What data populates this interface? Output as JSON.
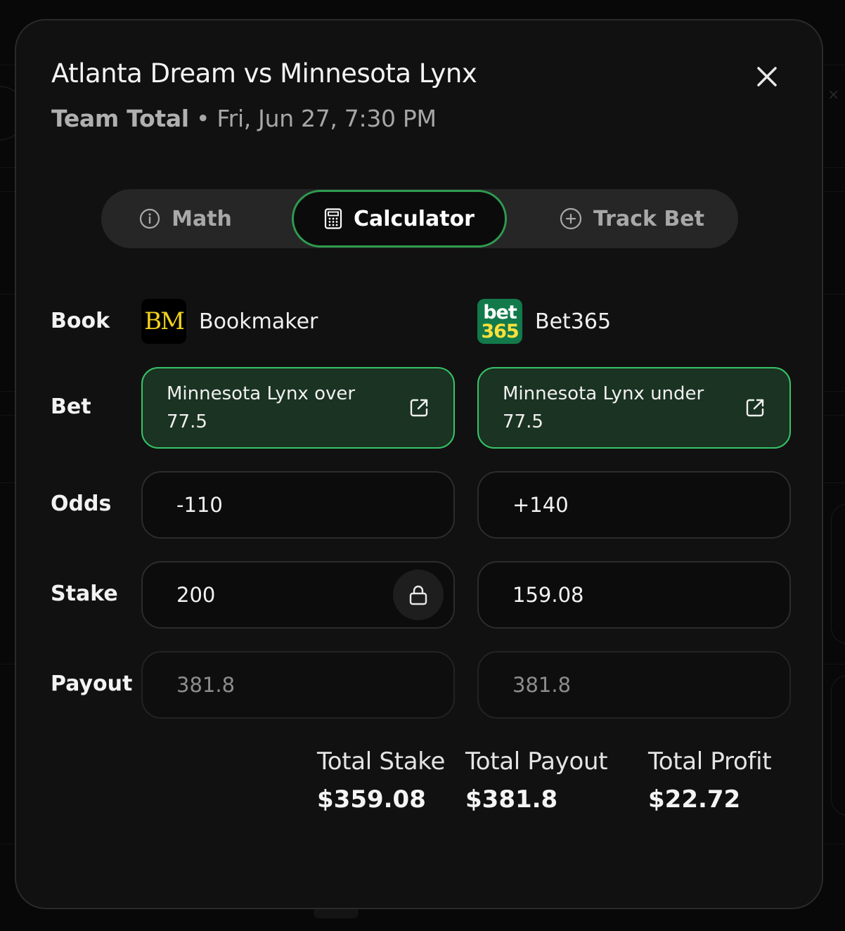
{
  "header": {
    "title": "Atlanta Dream vs Minnesota Lynx",
    "market": "Team Total",
    "separator": "•",
    "datetime": "Fri, Jun 27, 7:30 PM"
  },
  "tabs": [
    {
      "label": "Math",
      "icon": "info-icon"
    },
    {
      "label": "Calculator",
      "icon": "calculator-icon",
      "active": true
    },
    {
      "label": "Track Bet",
      "icon": "plus-circle-icon"
    }
  ],
  "labels": {
    "book": "Book",
    "bet": "Bet",
    "odds": "Odds",
    "stake": "Stake",
    "payout": "Payout"
  },
  "legs": [
    {
      "book_name": "Bookmaker",
      "book_logo_text": "BM",
      "bet": "Minnesota Lynx over 77.5",
      "odds": "-110",
      "stake": "200",
      "stake_locked": true,
      "payout": "381.8"
    },
    {
      "book_name": "Bet365",
      "book_logo_text_top": "bet",
      "book_logo_text_bottom": "365",
      "bet": "Minnesota Lynx under 77.5",
      "odds": "+140",
      "stake": "159.08",
      "payout": "381.8"
    }
  ],
  "totals": {
    "stake_label": "Total Stake",
    "stake_value": "$359.08",
    "payout_label": "Total Payout",
    "payout_value": "$381.8",
    "profit_label": "Total Profit",
    "profit_value": "$22.72"
  },
  "colors": {
    "accent_green": "#35c466",
    "bet_bg": "#1b3322",
    "modal_bg": "#111112",
    "bm_logo_yellow": "#f0d21c",
    "bet365_green": "#127a4a",
    "bet365_yellow": "#ffe03c"
  }
}
